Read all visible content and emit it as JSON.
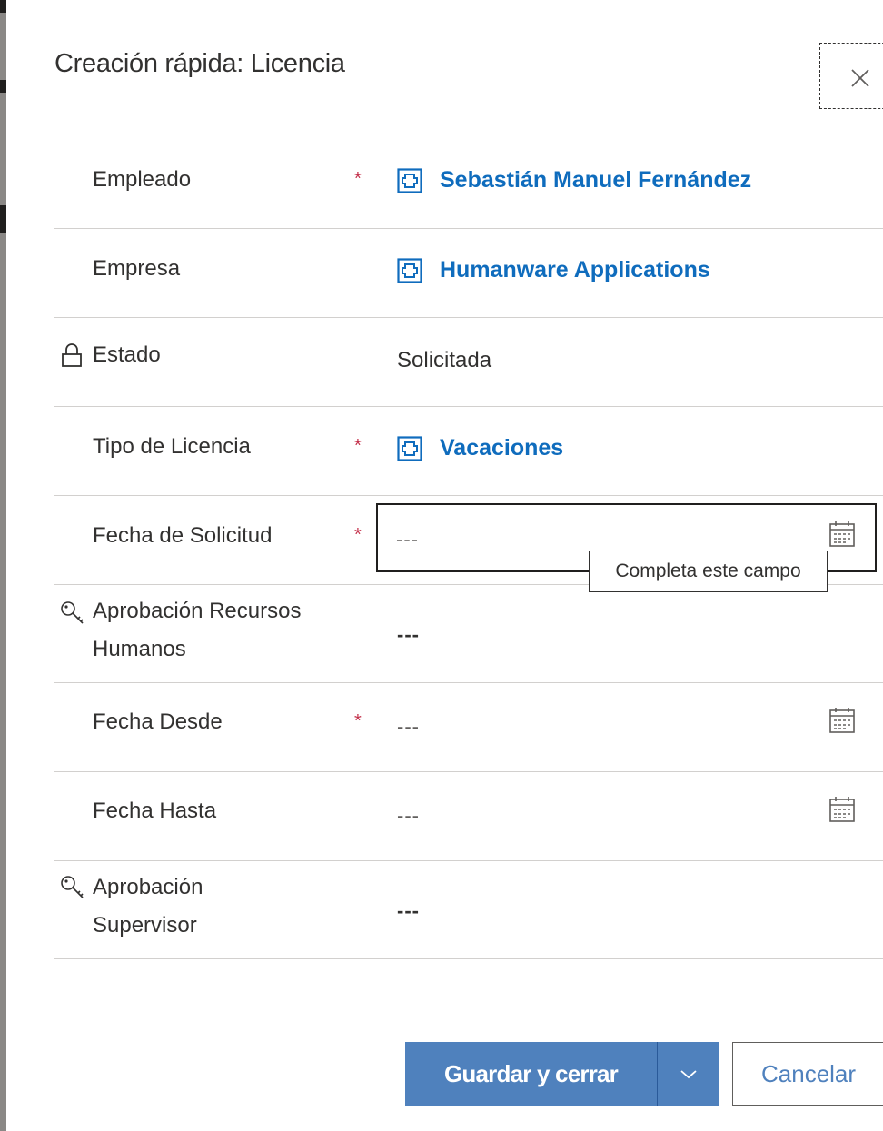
{
  "dialog": {
    "title": "Creación rápida: Licencia"
  },
  "fields": {
    "empleado": {
      "label": "Empleado",
      "required": "*",
      "value": "Sebastián Manuel Fernández"
    },
    "empresa": {
      "label": "Empresa",
      "value": "Humanware Applications"
    },
    "estado": {
      "label": "Estado",
      "value": "Solicitada",
      "icon": "lock-icon"
    },
    "tipo": {
      "label": "Tipo de Licencia",
      "required": "*",
      "value": "Vacaciones"
    },
    "fecha_solicitud": {
      "label": "Fecha de Solicitud",
      "required": "*",
      "value": "---",
      "tooltip": "Completa este campo"
    },
    "aprob_rrhh": {
      "label_line1": "Aprobación Recursos",
      "label_line2": "Humanos",
      "value": "---",
      "icon": "key-icon"
    },
    "fecha_desde": {
      "label": "Fecha Desde",
      "required": "*",
      "value": "---"
    },
    "fecha_hasta": {
      "label": "Fecha Hasta",
      "value": "---"
    },
    "aprob_sup": {
      "label_line1": "Aprobación",
      "label_line2": "Supervisor",
      "value": "---",
      "icon": "key-icon"
    }
  },
  "footer": {
    "save_label": "Guardar y cerrar",
    "cancel_label": "Cancelar"
  },
  "colors": {
    "accent": "#4f81bd",
    "link": "#0f6cbd",
    "required": "#c4314b"
  }
}
